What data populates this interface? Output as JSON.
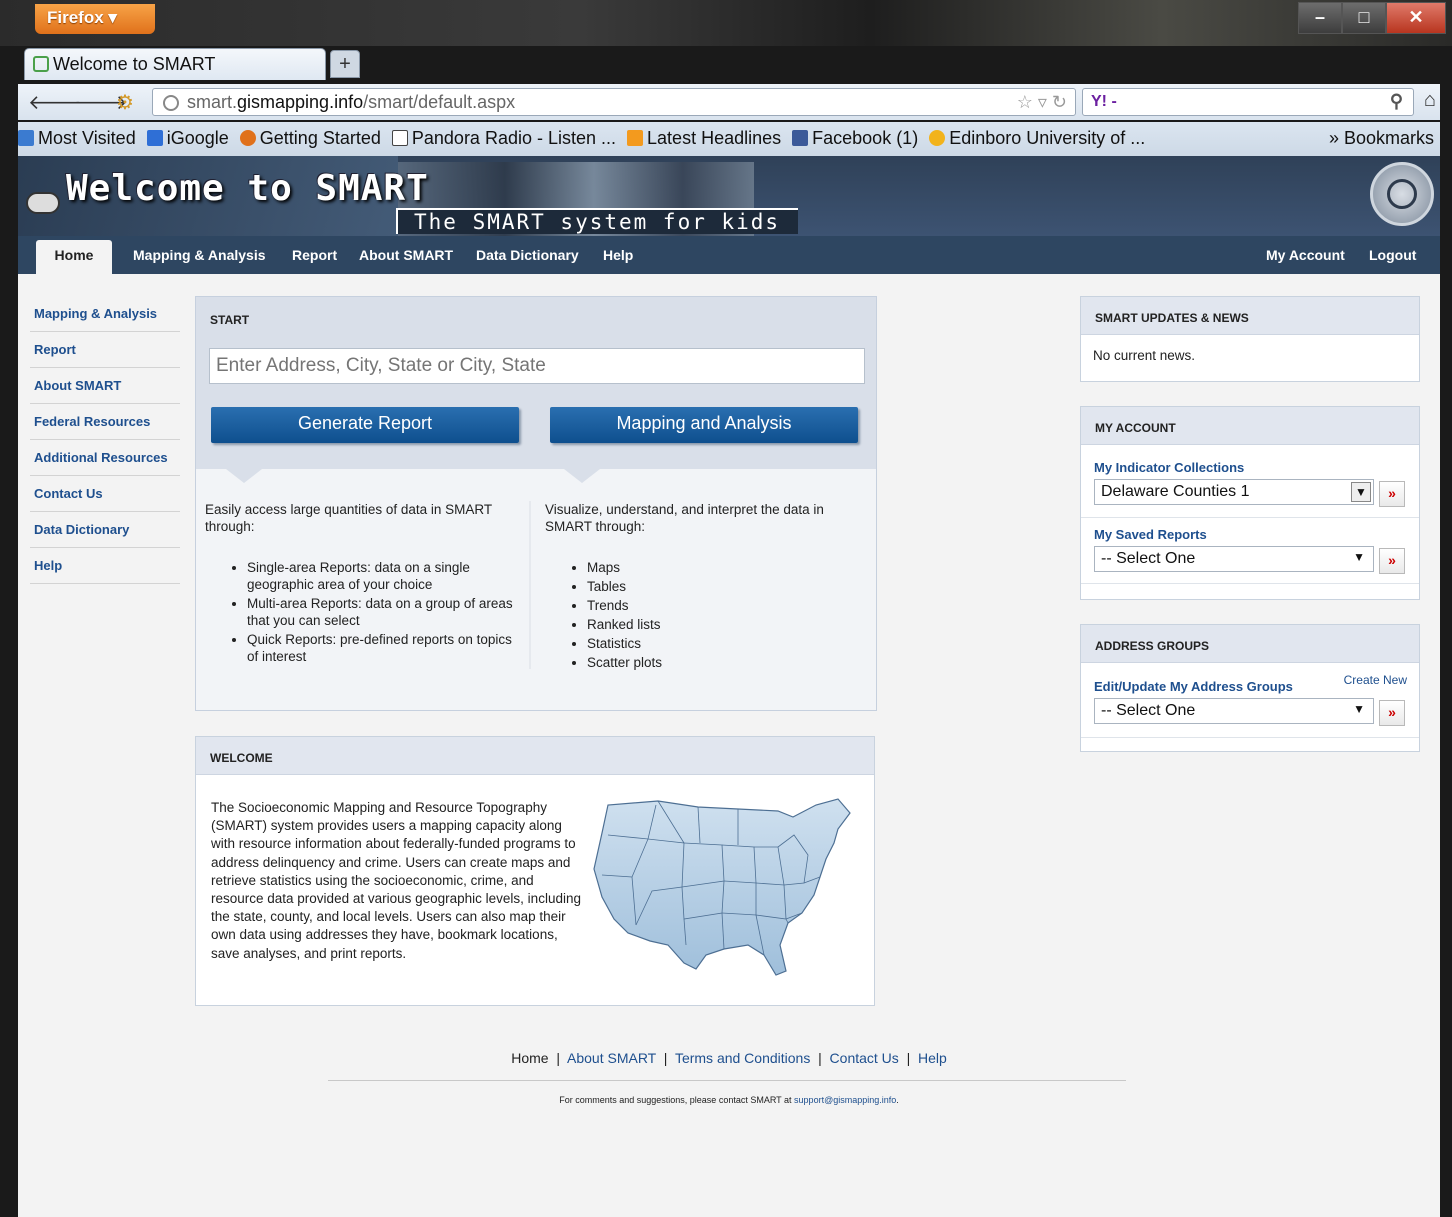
{
  "browser": {
    "menu_button": "Firefox ▾",
    "tab_title": "Welcome to SMART",
    "new_tab": "+",
    "url_prefix": "smart.",
    "url_host": "gismapping.info",
    "url_path": "/smart/default.aspx",
    "search_engine": "Y! -",
    "bookmarks": [
      "Most Visited",
      "iGoogle",
      "Getting Started",
      "Pandora Radio - Listen ...",
      "Latest Headlines",
      "Facebook (1)",
      "Edinboro University of ..."
    ],
    "bookmarks_menu": "» Bookmarks"
  },
  "site": {
    "title": "Welcome to SMART",
    "tagline": "The SMART system for kids",
    "nav": [
      "Home",
      "Mapping & Analysis",
      "Report",
      "About SMART",
      "Data Dictionary",
      "Help"
    ],
    "nav_right": [
      "My Account",
      "Logout"
    ],
    "sidebar": [
      "Mapping & Analysis",
      "Report",
      "About SMART",
      "Federal Resources",
      "Additional Resources",
      "Contact Us",
      "Data Dictionary",
      "Help"
    ]
  },
  "start": {
    "heading": "START",
    "placeholder": "Enter Address, City, State or City, State",
    "generate_button": "Generate Report",
    "mapping_button": "Mapping and Analysis",
    "left_intro": "Easily access large quantities of data in SMART through:",
    "left_items": [
      "Single-area Reports: data on a single geographic area of your choice",
      "Multi-area Reports: data on a group of areas that you can select",
      "Quick Reports: pre-defined reports on topics of interest"
    ],
    "right_intro": "Visualize, understand, and interpret the data in SMART through:",
    "right_items": [
      "Maps",
      "Tables",
      "Trends",
      "Ranked lists",
      "Statistics",
      "Scatter plots"
    ]
  },
  "welcome": {
    "heading": "WELCOME",
    "body": "The Socioeconomic Mapping and Resource Topography (SMART) system provides users a mapping capacity along with resource information about federally-funded programs to address delinquency and crime. Users can create maps and retrieve statistics using the socioeconomic, crime, and resource data provided at various geographic levels, including the state, county, and local levels. Users can also map their own data using addresses they have, bookmark locations, save analyses, and print reports."
  },
  "news": {
    "heading": "SMART UPDATES & NEWS",
    "body": "No current news."
  },
  "account": {
    "heading": "MY ACCOUNT",
    "collections_label": "My Indicator Collections",
    "collections_value": "Delaware Counties 1",
    "reports_label": "My Saved Reports",
    "reports_value": "-- Select One"
  },
  "address_groups": {
    "heading": "ADDRESS GROUPS",
    "label": "Edit/Update My Address Groups",
    "create_new": "Create New",
    "value": "-- Select One"
  },
  "footer": {
    "links": [
      "Home",
      "About SMART",
      "Terms and Conditions",
      "Contact Us",
      "Help"
    ],
    "note": "For comments and suggestions, please contact SMART at",
    "email": "support@gismapping.info",
    "note_end": "."
  },
  "go_glyph": "»"
}
